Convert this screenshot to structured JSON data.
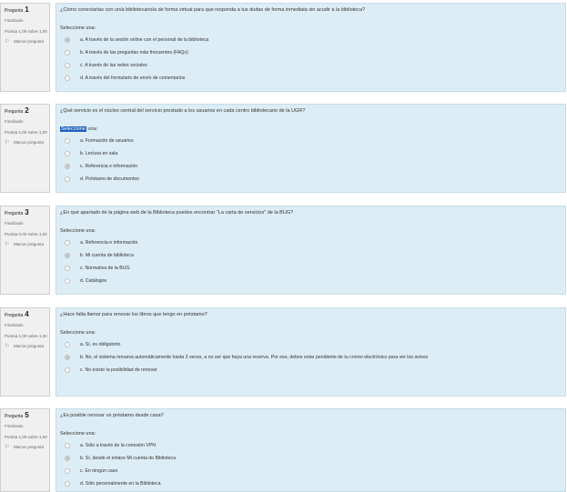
{
  "questions": [
    {
      "title": "Pregunta",
      "number": "1",
      "state": "Finalizado",
      "grade": "Puntúa 1,00 sobre 1,00",
      "flag_label": "Marcar pregunta",
      "text": "¿Cómo conectarías con un/a bibliotecario/a de forma virtual para que responda a tus dudas de forma inmediata sin acudir a la biblioteca?",
      "prompt": "Seleccione una:",
      "options": [
        {
          "label": "a. A través de la sesión online con el personal de la biblioteca",
          "checked": true
        },
        {
          "label": "b. A través de las preguntas más frecuentes (FAQs)",
          "checked": false
        },
        {
          "label": "c. A través de las redes sociales",
          "checked": false
        },
        {
          "label": "d. A través del formulario de envío de comentarios",
          "checked": false
        }
      ]
    },
    {
      "title": "Pregunta",
      "number": "2",
      "state": "Finalizado",
      "grade": "Puntúa 1,00 sobre 1,00",
      "flag_label": "Marcar pregunta",
      "text": "¿Qué servicio es el núcleo central del servicio prestado a los usuarios en cada centro bibliotecario de la UGR?",
      "prompt_highlight": "Seleccione",
      "prompt_rest": " una:",
      "options": [
        {
          "label": "a. Formación de usuarios",
          "checked": false
        },
        {
          "label": "b. Lectura en sala",
          "checked": false
        },
        {
          "label": "c. Referencia e información",
          "checked": true
        },
        {
          "label": "d. Préstamo de documentos",
          "checked": false
        }
      ]
    },
    {
      "title": "Pregunta",
      "number": "3",
      "state": "Finalizado",
      "grade": "Puntúa 0,00 sobre 1,00",
      "flag_label": "Marcar pregunta",
      "text": "¿En qué apartado de la página web de la Biblioteca puedes encontrar \"La carta de servicios\" de la BUG?",
      "prompt": "Seleccione una:",
      "options": [
        {
          "label": "a. Referencia e información",
          "checked": false
        },
        {
          "label": "b. Mi cuenta de biblioteca",
          "checked": true
        },
        {
          "label": "c. Normativa de la BUG",
          "checked": false
        },
        {
          "label": "d. Catálogos",
          "checked": false
        }
      ]
    },
    {
      "title": "Pregunta",
      "number": "4",
      "state": "Finalizado",
      "grade": "Puntúa 1,00 sobre 1,00",
      "flag_label": "Marcar pregunta",
      "text": "¿Hace falta llamar para renovar los libros que tengo en préstamo?",
      "prompt": "Seleccione una:",
      "options": [
        {
          "label": "a. Sí, es obligatorio",
          "checked": false
        },
        {
          "label": "b. No, el sistema renueva automáticamente hasta 3 veces, a no ser que haya una reserva. Por eso, debes estar pendiente de tu correo electrónico para ver los avisos",
          "checked": true
        },
        {
          "label": "c. No existe la posibilidad de renovar",
          "checked": false
        }
      ]
    },
    {
      "title": "Pregunta",
      "number": "5",
      "state": "Finalizado",
      "grade": "Puntúa 1,00 sobre 1,00",
      "flag_label": "Marcar pregunta",
      "text": "¿Es posible renovar un préstamo desde casa?",
      "prompt": "Seleccione una:",
      "options": [
        {
          "label": "a. Sólo a través de la conexión VPN",
          "checked": false
        },
        {
          "label": "b. Sí, desde el enlace Mi cuenta de Biblioteca",
          "checked": true
        },
        {
          "label": "c. En ningún caso",
          "checked": false
        },
        {
          "label": "d. Sólo personalmente en la Biblioteca",
          "checked": false
        }
      ]
    }
  ]
}
